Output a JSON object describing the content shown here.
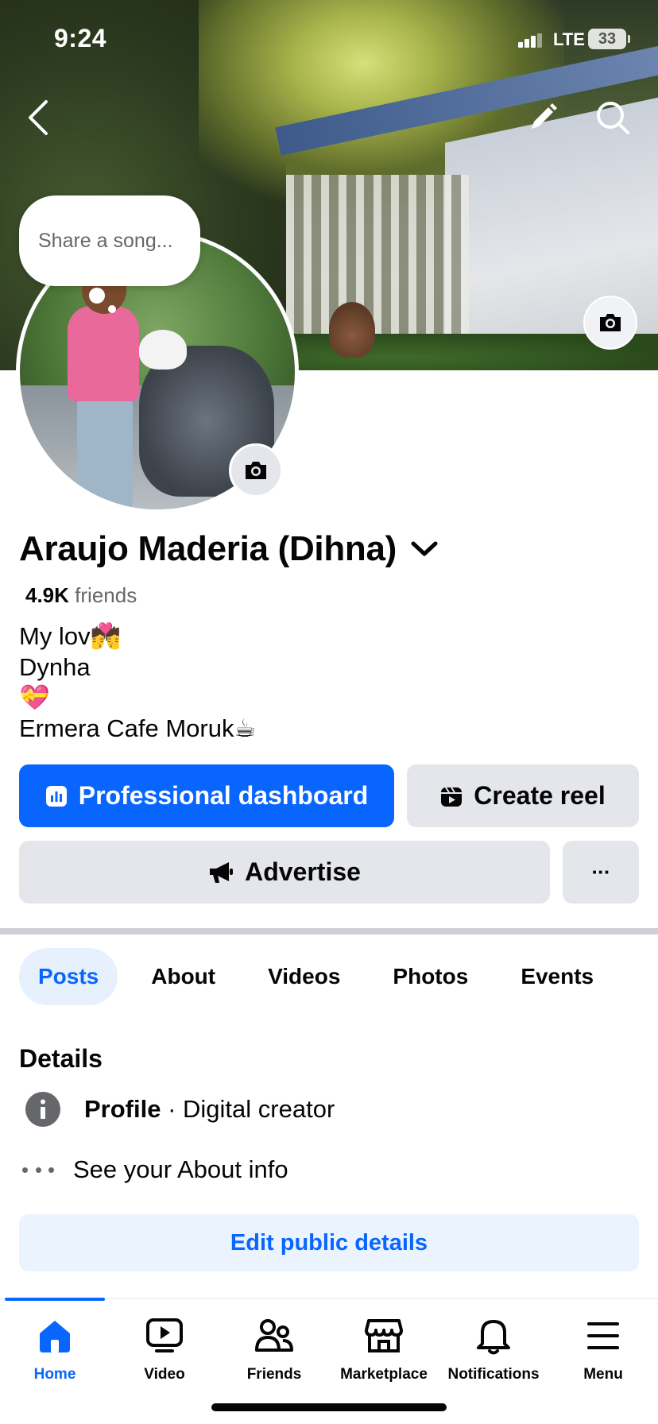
{
  "status_bar": {
    "time": "9:24",
    "network": "LTE",
    "battery": "33"
  },
  "song_bubble": {
    "placeholder": "Share a song..."
  },
  "profile": {
    "name": "Araujo Maderia (Dihna)",
    "friends_count": "4.9K",
    "friends_label": "friends",
    "bio_lines": [
      "My lov💏",
      "Dynha",
      "💝",
      "Ermera Cafe Moruk☕"
    ]
  },
  "actions": {
    "professional_dashboard": "Professional dashboard",
    "create_reel": "Create reel",
    "advertise": "Advertise",
    "more": "···"
  },
  "tabs": [
    "Posts",
    "About",
    "Videos",
    "Photos",
    "Events"
  ],
  "details": {
    "title": "Details",
    "profile_label": "Profile",
    "profile_sep": " · ",
    "profile_value": "Digital creator",
    "see_about": "See your About info",
    "edit_button": "Edit public details"
  },
  "nav": [
    "Home",
    "Video",
    "Friends",
    "Marketplace",
    "Notifications",
    "Menu"
  ],
  "colors": {
    "accent": "#0866ff",
    "button_gray": "#e4e6eb",
    "text": "#050505",
    "muted": "#65676b"
  },
  "icons": [
    "back-icon",
    "edit-pencil-icon",
    "search-icon",
    "camera-icon",
    "chevron-down-icon",
    "dashboard-chart-icon",
    "reel-icon",
    "megaphone-icon",
    "info-icon",
    "more-dots-icon",
    "home-icon",
    "video-icon",
    "friends-icon",
    "marketplace-icon",
    "bell-icon",
    "menu-icon"
  ]
}
